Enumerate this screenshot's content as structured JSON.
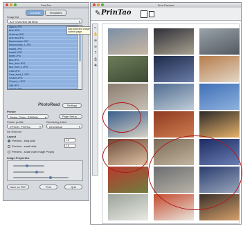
{
  "left_panel": {
    "title": "PrintTao",
    "tabs": [
      "Controls",
      "Templates"
    ],
    "image_list_label": "Image list",
    "image_list_select": "ALT Overview (all files)",
    "files": [
      "Agarra.JPG",
      "Arch.JPG",
      "Archtree.JPG",
      "Arch ard.JPG",
      "Beachchairs.JPG",
      "Beachchairs_1.JPG",
      "boats1.JPG",
      "boats2.JPG",
      "Bottle.JPG",
      "Bus.JPG",
      "Bus_front.JPG",
      "Bus_front_1.JPG",
      "Cafe.JPG",
      "Cars_front_1.JPG",
      "Church.JPG",
      "Church_1.JPG",
      "Cliff.JPG",
      "Cloudy.JPG",
      "Detail.JPG",
      "Door.JPG",
      "Bus.JPG"
    ],
    "tooltip": "Add selected images from Finder to current page",
    "logo_text": "PhotoRead",
    "settings_button": "Settings",
    "printer_label": "Printer",
    "printer_select": "Stylus_Photo_R300Me",
    "page_setup_button": "Page Setup...",
    "printer_profile_label": "Printer profile",
    "printer_profile_select": "EPSON_PGP.icc",
    "rendering_intent_label": "Rendering intent",
    "rendering_intent_select": "perceptual",
    "ink_reserve_label": "Ink Reserve",
    "layout_label": "Layout",
    "layout_options": [
      {
        "label": "Preview - long side",
        "selected": true
      },
      {
        "label": "Preview - small side",
        "selected": false
      },
      {
        "label": "Preview - scale (see Image Props)",
        "selected": false
      }
    ],
    "field_values": [
      "1.5",
      "1.5"
    ],
    "image_props_label": "Image Properties",
    "save_pdf_button": "Save as PDF",
    "print_button": "Print",
    "quit_button": "Quit"
  },
  "right_panel": {
    "title": "Print Preview",
    "brand": "PrinTao",
    "tools": [
      "↖",
      "✋",
      "⊕",
      "⊖",
      "T",
      "⎙",
      "✚"
    ]
  },
  "photos": [
    {
      "name": "photo-coast",
      "colors": [
        "#7c8fa6",
        "#c9b7a2"
      ]
    },
    {
      "name": "photo-interior",
      "colors": [
        "#2f3038",
        "#a8a18f"
      ]
    },
    {
      "name": "photo-statue",
      "colors": [
        "#9aa3aa",
        "#52585f"
      ]
    },
    {
      "name": "photo-trees",
      "colors": [
        "#6d7d5a",
        "#3c4a33"
      ]
    },
    {
      "name": "photo-harbor-night",
      "colors": [
        "#1d2a48",
        "#6a7ca8"
      ]
    },
    {
      "name": "photo-balcony",
      "colors": [
        "#b67c4a",
        "#e3d7c7"
      ]
    },
    {
      "name": "photo-ruin",
      "colors": [
        "#8a7c6e",
        "#c8c0b6"
      ]
    },
    {
      "name": "photo-lighthouse",
      "colors": [
        "#4f6c8f",
        "#c0ccd8"
      ]
    },
    {
      "name": "photo-sky",
      "colors": [
        "#3f6fb6",
        "#8fb2de"
      ]
    },
    {
      "name": "photo-sailboat",
      "colors": [
        "#3b5f8c",
        "#d8d4c6"
      ]
    },
    {
      "name": "photo-red-rock",
      "colors": [
        "#8e3a23",
        "#cf7d4f"
      ]
    },
    {
      "name": "photo-arch",
      "colors": [
        "#2c2a28",
        "#e8b26a"
      ]
    },
    {
      "name": "photo-glasses",
      "colors": [
        "#6b4a3a",
        "#e0c4a4"
      ]
    },
    {
      "name": "photo-church",
      "colors": [
        "#7a6a57",
        "#c2b59f"
      ]
    },
    {
      "name": "photo-bus-night",
      "colors": [
        "#1b2b63",
        "#6b7fb3"
      ]
    },
    {
      "name": "photo-flowers",
      "colors": [
        "#b83a2f",
        "#6f7e3e"
      ]
    },
    {
      "name": "photo-street",
      "colors": [
        "#6b6d70",
        "#b8b3a8"
      ]
    },
    {
      "name": "photo-car",
      "colors": [
        "#2a3d6e",
        "#9aa6bd"
      ]
    },
    {
      "name": "photo-mountain",
      "colors": [
        "#9aa39a",
        "#e9e9e3"
      ]
    },
    {
      "name": "photo-bus",
      "colors": [
        "#c44a2e",
        "#e9e6de"
      ]
    },
    {
      "name": "photo-arch-street",
      "colors": [
        "#3a302a",
        "#d5a06a"
      ]
    }
  ]
}
